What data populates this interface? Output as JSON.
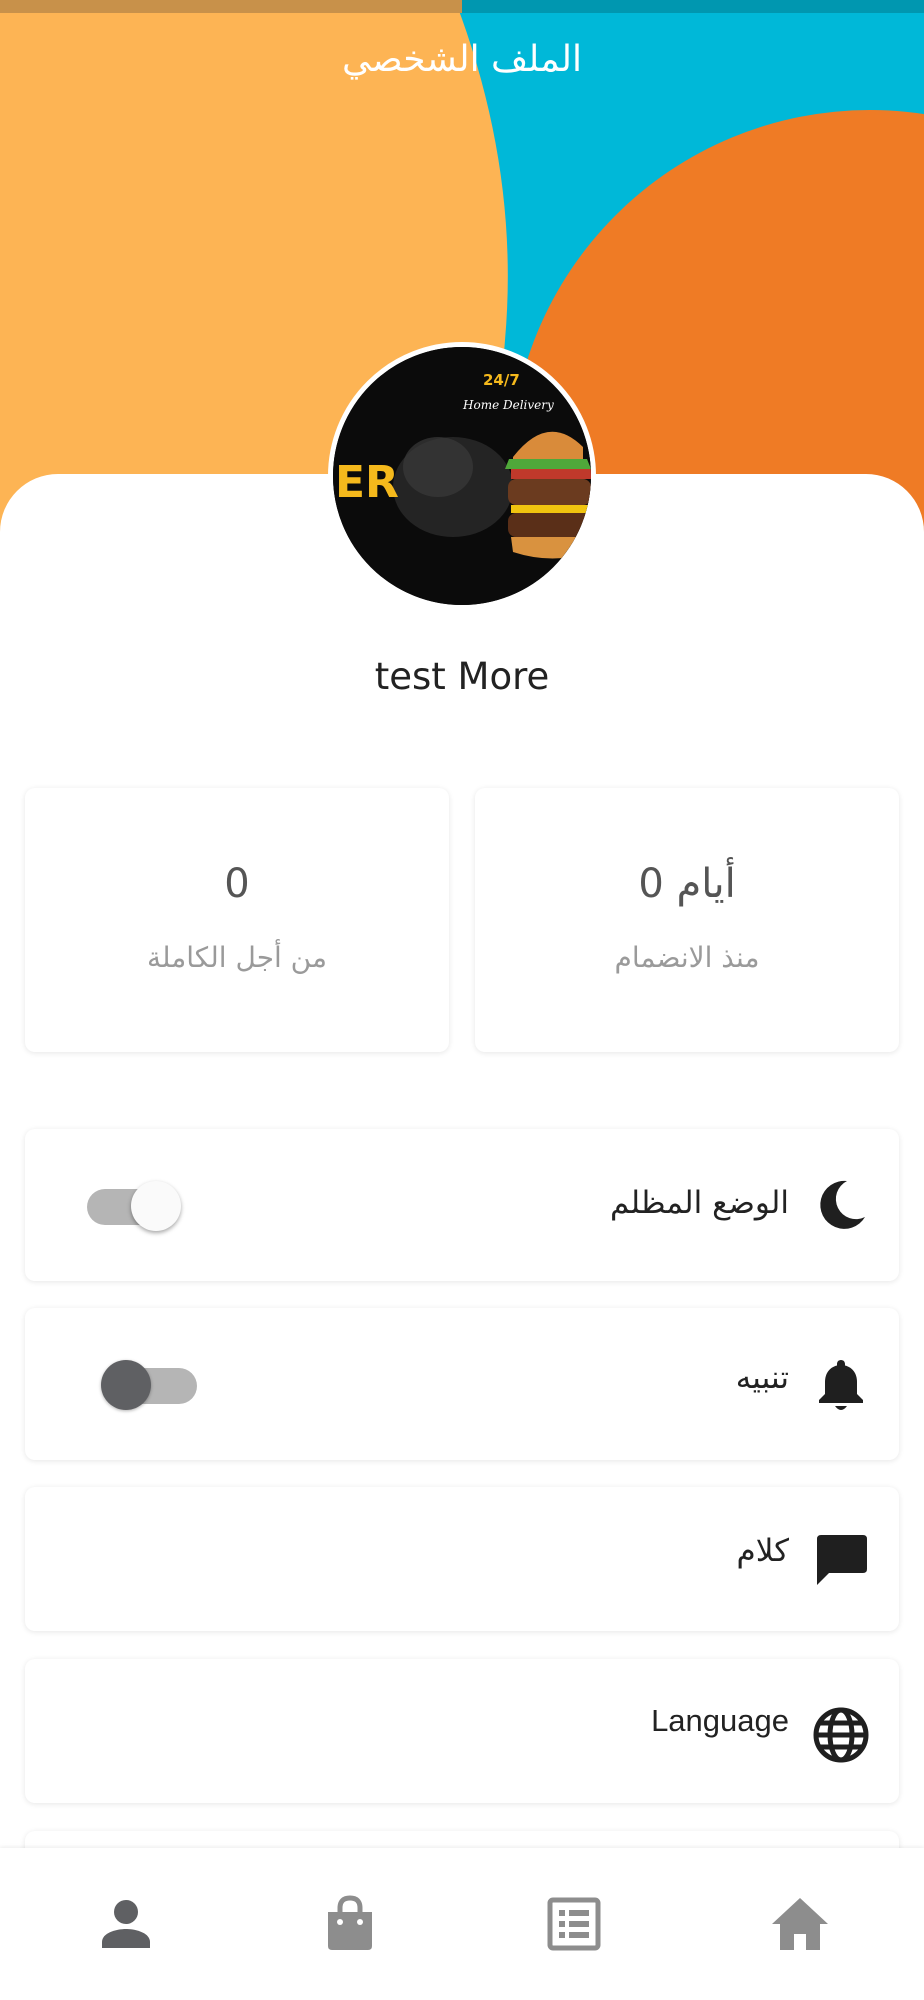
{
  "header": {
    "title": "الملف الشخصي"
  },
  "profile": {
    "name": "test More",
    "avatar_image_text": {
      "line1": "24/7",
      "line2": "Home Delivery",
      "partial_logo": "ER"
    }
  },
  "stats": [
    {
      "value": "0",
      "label": "من أجل الكاملة"
    },
    {
      "value": "0 أيام",
      "label": "منذ الانضمام"
    }
  ],
  "settings": {
    "dark_mode": {
      "label": "الوضع المظلم",
      "icon": "moon-icon",
      "enabled": true
    },
    "notifications": {
      "label": "تنبيه",
      "icon": "bell-icon",
      "enabled": false
    },
    "chat": {
      "label": "كلام",
      "icon": "chat-icon"
    },
    "language": {
      "label": "Language",
      "icon": "globe-icon"
    }
  },
  "bottom_nav": [
    {
      "icon": "person-icon",
      "active": true
    },
    {
      "icon": "shopping-bag-icon",
      "active": false
    },
    {
      "icon": "list-icon",
      "active": false
    },
    {
      "icon": "home-icon",
      "active": false
    }
  ],
  "colors": {
    "header_yellow": "#FDB454",
    "header_cyan": "#00B8D8",
    "header_orange": "#EF7B25",
    "icon_dark": "#1f1f1f",
    "nav_active": "#5f6063",
    "nav_inactive": "#8d8d8d"
  }
}
